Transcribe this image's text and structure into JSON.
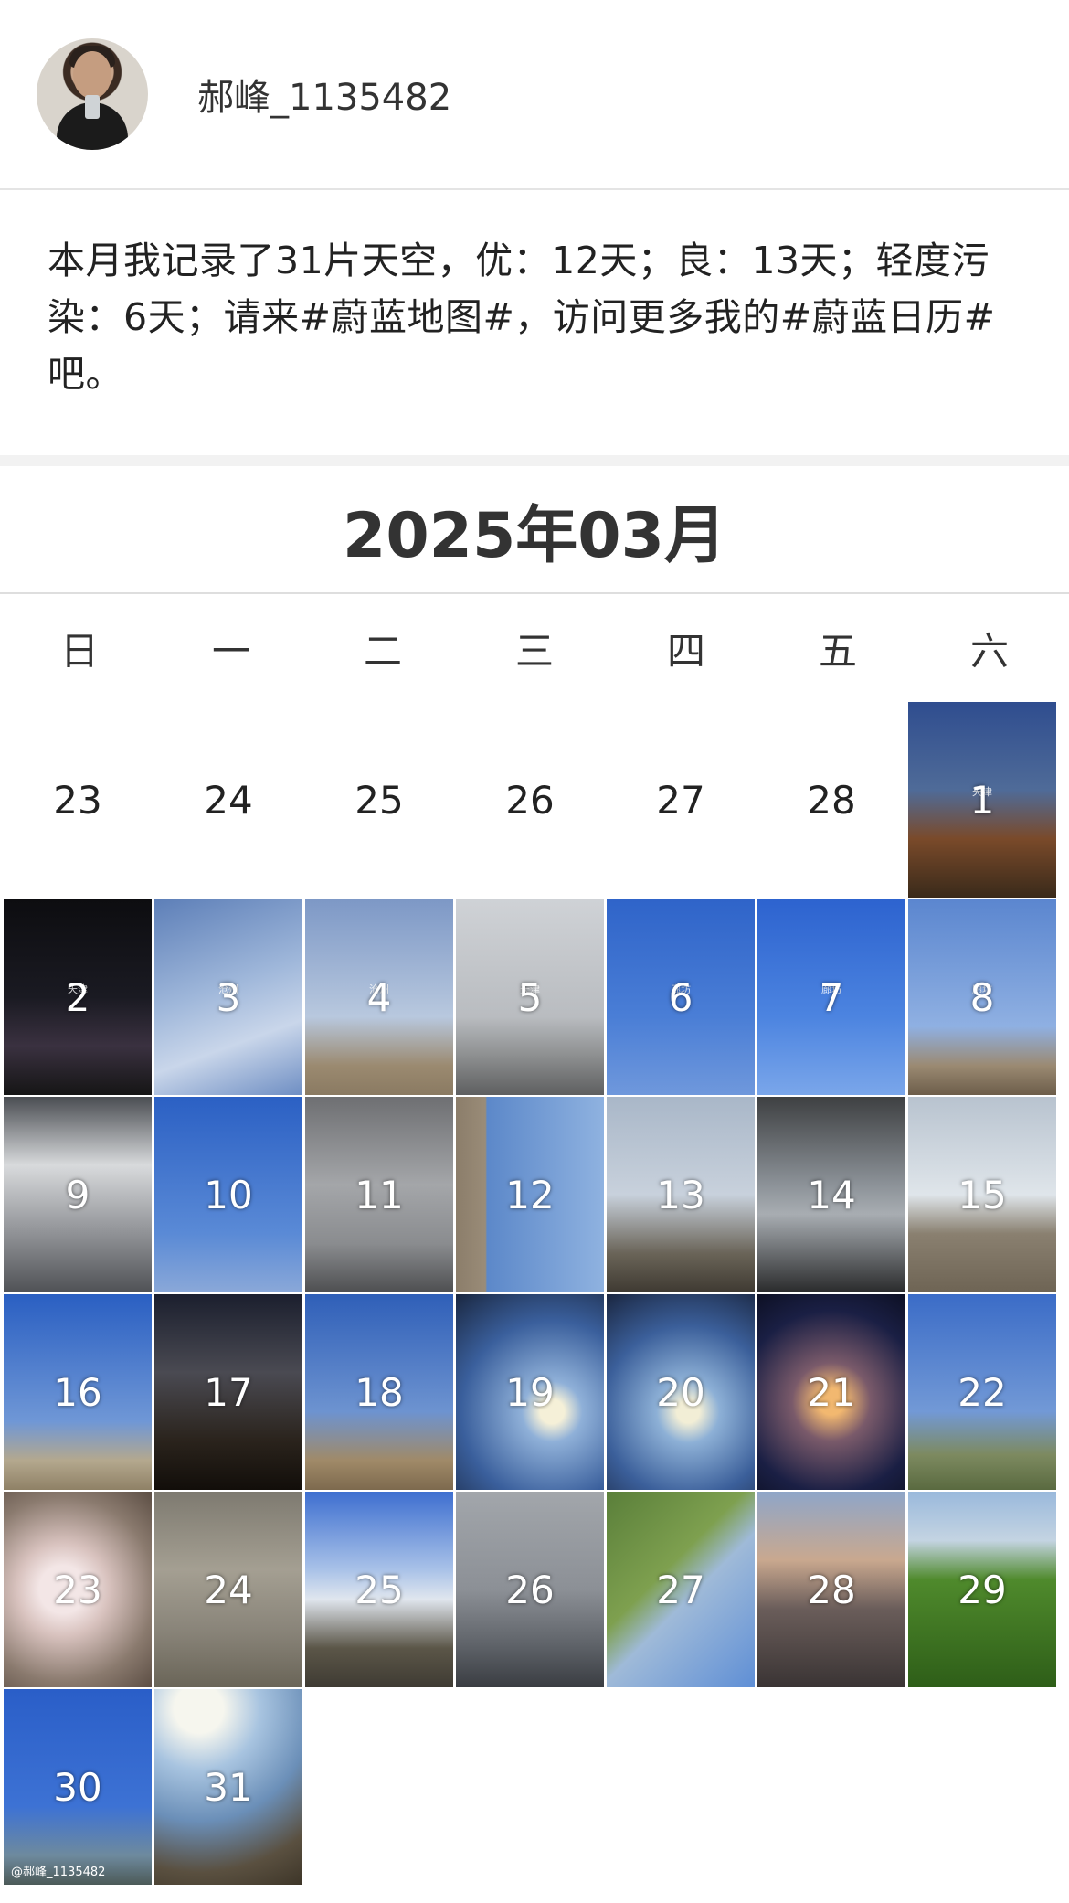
{
  "user": {
    "name": "郝峰_1135482"
  },
  "summary": {
    "text": "本月我记录了31片天空，优：12天；良：13天；轻度污染：6天；请来#蔚蓝地图#，访问更多我的#蔚蓝日历#吧。"
  },
  "calendar": {
    "title": "2025年03月",
    "weekdays": [
      "日",
      "一",
      "二",
      "三",
      "四",
      "五",
      "六"
    ],
    "prev_month_days": [
      "23",
      "24",
      "25",
      "26",
      "27",
      "28"
    ],
    "days": [
      {
        "num": "1",
        "bg": "linear-gradient(180deg,#2f4d8f 0%,#4f6b98 45%,#7a4a2a 70%,#3a2a1a 100%)"
      },
      {
        "num": "2",
        "bg": "linear-gradient(180deg,#0d0d10 0%,#1a1a22 50%,#3a3140 75%,#151515 100%)"
      },
      {
        "num": "3",
        "bg": "linear-gradient(160deg,#5d7fb8 0%,#9fb7da 45%,#c9d6ea 70%,#6e8ec3 100%)"
      },
      {
        "num": "4",
        "bg": "linear-gradient(180deg,#7d98c6 0%,#b8c8de 60%,#9b8a70 85%,#8a7a62 100%)"
      },
      {
        "num": "5",
        "bg": "linear-gradient(180deg,#cfd2d6 0%,#b9bcc0 60%,#8d8f90 80%,#5e5f60 100%)"
      },
      {
        "num": "6",
        "bg": "linear-gradient(180deg,#2f64c9 0%,#4a7ed6 60%,#6f98dc 100%)"
      },
      {
        "num": "7",
        "bg": "linear-gradient(180deg,#2d63cf 0%,#4c84e0 60%,#7aa6ea 100%)"
      },
      {
        "num": "8",
        "bg": "linear-gradient(180deg,#5b86cf 0%,#8fb0e2 65%,#9b8a72 85%,#6c5d4a 100%)"
      },
      {
        "num": "9",
        "bg": "linear-gradient(180deg,#4a4d52 0%,#d8dadc 35%,#9a9ca0 65%,#505256 100%)"
      },
      {
        "num": "10",
        "bg": "linear-gradient(180deg,#2b60c4 0%,#5a8ad6 70%,#8aa8d8 100%)"
      },
      {
        "num": "11",
        "bg": "linear-gradient(180deg,#6e6f72 0%,#a4a6a9 45%,#8a8c8f 75%,#4e4f51 100%)"
      },
      {
        "num": "12",
        "bg": "linear-gradient(90deg,#8b7d6a 0%,#9a8c78 20%,#5c88c9 21%,#8fb2e0 100%)"
      },
      {
        "num": "13",
        "bg": "linear-gradient(180deg,#a9b7c8 0%,#c8d1dc 50%,#6a6458 80%,#3f3a32 100%)"
      },
      {
        "num": "14",
        "bg": "linear-gradient(180deg,#3e4042 0%,#8c9298 45%,#a8adb2 60%,#2a2b2c 100%)"
      },
      {
        "num": "15",
        "bg": "linear-gradient(180deg,#b8c3cf 0%,#dfe5ea 50%,#8a8070 70%,#6e6454 100%)"
      },
      {
        "num": "16",
        "bg": "linear-gradient(180deg,#2a5fc2 0%,#6f97d6 65%,#b4a88e 85%,#8f8166 100%)"
      },
      {
        "num": "17",
        "bg": "linear-gradient(180deg,#1b1f2e 0%,#4a4a52 40%,#2a231c 75%,#120e0a 100%)"
      },
      {
        "num": "18",
        "bg": "linear-gradient(180deg,#2f5fb8 0%,#6d93d0 60%,#a08a68 85%,#7d6a4e 100%)"
      },
      {
        "num": "19",
        "bg": "radial-gradient(circle at 65% 60%,#f5f0d8 0 8%,#8fb0d8 20%,#3a5f9c 60%,#1a2740 100%)"
      },
      {
        "num": "20",
        "bg": "radial-gradient(circle at 55% 60%,#f2eed6 0 8%,#8db0d6 22%,#3b5f9a 60%,#1a2640 100%)"
      },
      {
        "num": "21",
        "bg": "radial-gradient(circle at 50% 55%,#f2b870 0 10%,#7a5a6a 30%,#1a1f44 70%,#0d1024 100%)"
      },
      {
        "num": "22",
        "bg": "linear-gradient(180deg,#3b6cc7 0%,#7299d6 60%,#7d8a60 82%,#5a6a40 100%)"
      },
      {
        "num": "23",
        "bg": "radial-gradient(circle at 40% 50%,#f3e6e6 0 18%,#d8c2be 35%,#8a7a6e 70%,#5c4e44 100%)"
      },
      {
        "num": "24",
        "bg": "linear-gradient(180deg,#7e7a70 0%,#a49f92 40%,#8a857a 70%,#6a6558 100%)"
      },
      {
        "num": "25",
        "bg": "linear-gradient(180deg,#3e6fd0 0%,#a9c2e8 40%,#e0e6ee 55%,#5b5648 80%,#3f3b33 100%)"
      },
      {
        "num": "26",
        "bg": "linear-gradient(180deg,#a2a6ab 0%,#8c9096 50%,#5c6066 80%,#3a3d42 100%)"
      },
      {
        "num": "27",
        "bg": "linear-gradient(135deg,#5a7f3a 0%,#7ea04f 40%,#9fbad8 55%,#5f8fd6 100%)"
      },
      {
        "num": "28",
        "bg": "linear-gradient(180deg,#8fa6c8 0%,#c9a88f 35%,#6a5d5a 60%,#3a3434 100%)"
      },
      {
        "num": "29",
        "bg": "linear-gradient(180deg,#9ab9dc 0%,#c4d4e2 25%,#4f8a2c 45%,#2e5e18 100%)"
      },
      {
        "num": "30",
        "bg": "linear-gradient(180deg,#2a5ec8 0%,#3d72d4 60%,#6e8a9e 85%,#4c5a58 100%)"
      },
      {
        "num": "31",
        "bg": "radial-gradient(circle at 30% 10%,#f6f6ee 0 12%,#a8c4e0 30%,#6b8fb8 55%,#5a5040 80%,#3d3528 100%)"
      }
    ],
    "watermarks": [
      "天津",
      "天津",
      "沧州",
      "沧州",
      "天津",
      "廊坊",
      "廊坊",
      "廊坊"
    ],
    "credit": "@郝峰_1135482"
  }
}
